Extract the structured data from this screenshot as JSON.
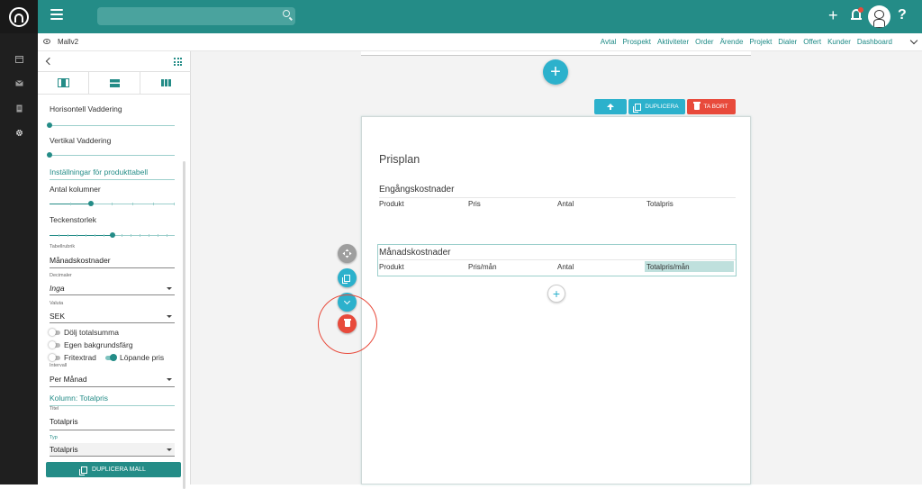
{
  "topbar": {
    "search_placeholder": "",
    "add_label": "+",
    "help_label": "?"
  },
  "subnav": {
    "template_name": "Mallv2",
    "links": [
      "Avtal",
      "Prospekt",
      "Aktiviteter",
      "Order",
      "Ärende",
      "Projekt",
      "Dialer",
      "Offert",
      "Kunder",
      "Dashboard"
    ]
  },
  "panel": {
    "horizontal_padding_label": "Horisontell Vaddering",
    "vertical_padding_label": "Vertikal Vaddering",
    "product_table_section": "Inställningar för produkttabell",
    "columns_label": "Antal kolumner",
    "columns_level": 0.33,
    "font_size_label": "Teckenstorlek",
    "font_size_level": 0.5,
    "table_caption_label": "Tabellrubrik",
    "table_caption_value": "Månadskostnader",
    "decimals_label": "Decimaler",
    "decimals_value": "Inga",
    "currency_label": "Valuta",
    "currency_value": "SEK",
    "toggle_hide_total": "Dölj totalsumma",
    "toggle_own_bg": "Egen bakgrundsfärg",
    "toggle_free_text": "Fritextrad",
    "toggle_running_price": "Löpande pris",
    "interval_label": "Intervall",
    "interval_value": "Per Månad",
    "column_section": "Kolumn: Totalpris",
    "title_label": "Titel",
    "title_value": "Totalpris",
    "type_label": "Typ",
    "type_value": "Totalpris",
    "duplicate_button": "DUPLICERA MALL"
  },
  "toolbar": {
    "duplicate_label": "DUPLICERA",
    "delete_label": "TA BORT"
  },
  "document": {
    "title": "Prisplan",
    "one_time_title": "Engångskostnader",
    "one_time_headers": [
      "Produkt",
      "Pris",
      "Antal",
      "Totalpris"
    ],
    "monthly_title": "Månadskostnader",
    "monthly_headers": [
      "Produkt",
      "Pris/mån",
      "Antal",
      "Totalpris/mån"
    ]
  },
  "colors": {
    "brand": "#248c87",
    "action": "#2cb1cc",
    "danger": "#e84a3b"
  },
  "icons": [
    "logo-icon",
    "calendar-icon",
    "mail-icon",
    "document-icon",
    "gear-icon",
    "menu-icon",
    "search-icon",
    "bell-icon",
    "eye-icon",
    "grid-icon",
    "move-icon",
    "copy-icon",
    "chevron-down-icon",
    "trash-icon",
    "arrow-up-icon"
  ]
}
